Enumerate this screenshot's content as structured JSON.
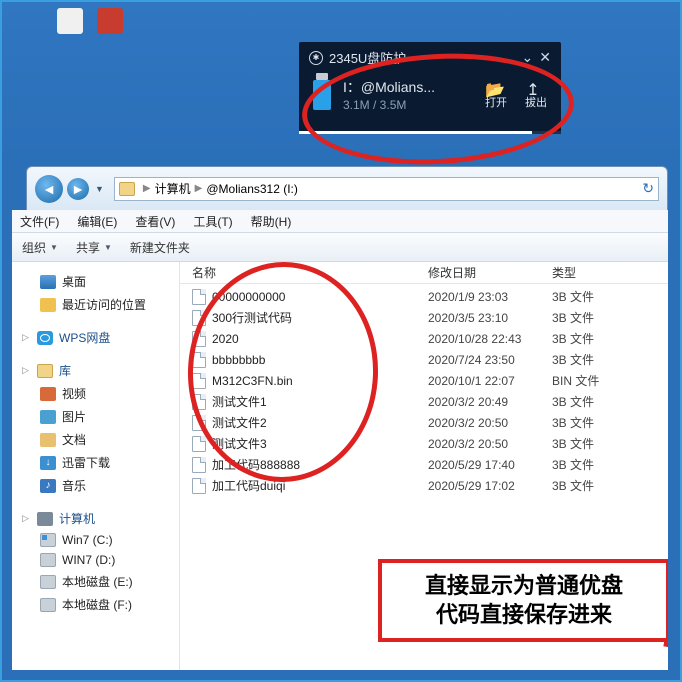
{
  "notification": {
    "title": "2345U盘防护",
    "drive_label": "I：@Molians...",
    "usage": "3.1M / 3.5M",
    "open_label": "打开",
    "eject_label": "拔出"
  },
  "address_bar": {
    "crumb1": "计算机",
    "crumb2": "@Molians312 (I:)"
  },
  "menu": {
    "file": "文件(F)",
    "edit": "编辑(E)",
    "view": "查看(V)",
    "tools": "工具(T)",
    "help": "帮助(H)"
  },
  "toolbar": {
    "organize": "组织",
    "share": "共享",
    "newfolder": "新建文件夹"
  },
  "sidebar": {
    "desktop": "桌面",
    "recent": "最近访问的位置",
    "wps": "WPS网盘",
    "library": "库",
    "video": "视频",
    "pictures": "图片",
    "documents": "文档",
    "downloads": "迅雷下载",
    "music": "音乐",
    "computer": "计算机",
    "drive_c": "Win7 (C:)",
    "drive_d": "WIN7 (D:)",
    "drive_e": "本地磁盘 (E:)",
    "drive_f": "本地磁盘 (F:)"
  },
  "columns": {
    "name": "名称",
    "date": "修改日期",
    "type": "类型"
  },
  "files": [
    {
      "name": "00000000000",
      "date": "2020/1/9 23:03",
      "type": "3B 文件"
    },
    {
      "name": "300行测试代码",
      "date": "2020/3/5 23:10",
      "type": "3B 文件"
    },
    {
      "name": "2020",
      "date": "2020/10/28 22:43",
      "type": "3B 文件"
    },
    {
      "name": "bbbbbbbb",
      "date": "2020/7/24 23:50",
      "type": "3B 文件"
    },
    {
      "name": "M312C3FN.bin",
      "date": "2020/10/1 22:07",
      "type": "BIN 文件"
    },
    {
      "name": "测试文件1",
      "date": "2020/3/2 20:49",
      "type": "3B 文件"
    },
    {
      "name": "测试文件2",
      "date": "2020/3/2 20:50",
      "type": "3B 文件"
    },
    {
      "name": "测试文件3",
      "date": "2020/3/2 20:50",
      "type": "3B 文件"
    },
    {
      "name": "加工代码888888",
      "date": "2020/5/29 17:40",
      "type": "3B 文件"
    },
    {
      "name": "加工代码duiqi",
      "date": "2020/5/29 17:02",
      "type": "3B 文件"
    }
  ],
  "banner": {
    "line1": "直接显示为普通优盘",
    "line2": "代码直接保存进来"
  }
}
